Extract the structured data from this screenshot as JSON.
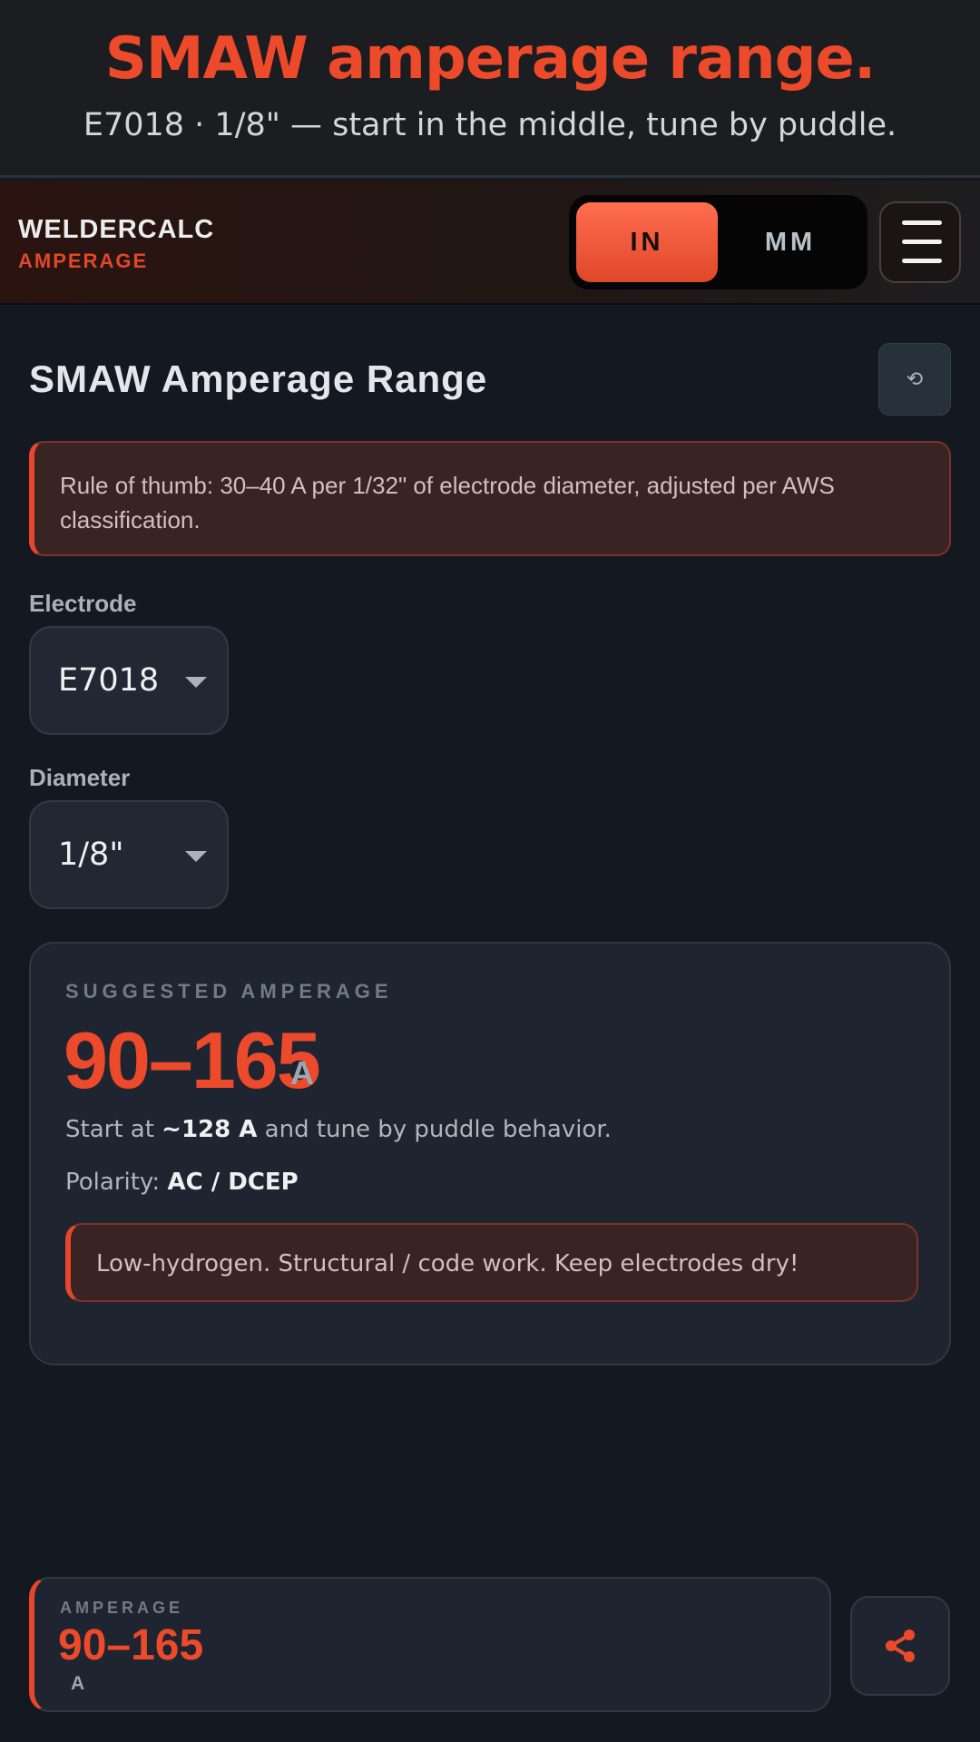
{
  "banner": {
    "title": "SMAW amperage range.",
    "subtitle": "E7018 · 1/8\" — start in the middle, tune by puddle."
  },
  "header": {
    "brand": "WELDERCALC",
    "section": "AMPERAGE",
    "units": [
      {
        "label": "IN",
        "active": true
      },
      {
        "label": "MM",
        "active": false
      }
    ]
  },
  "main": {
    "title": "SMAW Amperage Range",
    "tip": "Rule of thumb: 30–40 A per 1/32\" of electrode diameter, adjusted per AWS classification.",
    "electrode": {
      "label": "Electrode",
      "value": "E7018"
    },
    "diameter": {
      "label": "Diameter",
      "value": "1/8\""
    },
    "result": {
      "caption": "SUGGESTED AMPERAGE",
      "range": "90–165",
      "unit": "A",
      "start_prefix": "Start at ",
      "start_value": "~128 A",
      "start_suffix": " and tune by puddle behavior.",
      "polarity_label": "Polarity: ",
      "polarity_value": "AC / DCEP",
      "note": "Low-hydrogen. Structural / code work. Keep electrodes dry!"
    }
  },
  "bottom": {
    "caption": "AMPERAGE",
    "range": "90–165",
    "unit": "A"
  },
  "colors": {
    "accent": "#ec4a2a",
    "background": "#141820",
    "card": "#1e2530",
    "warning_bg": "#3a2323"
  },
  "icons": {
    "reset": "reset-icon",
    "menu": "menu-icon",
    "share": "share-icon",
    "dropdown": "chevron-down-icon"
  }
}
